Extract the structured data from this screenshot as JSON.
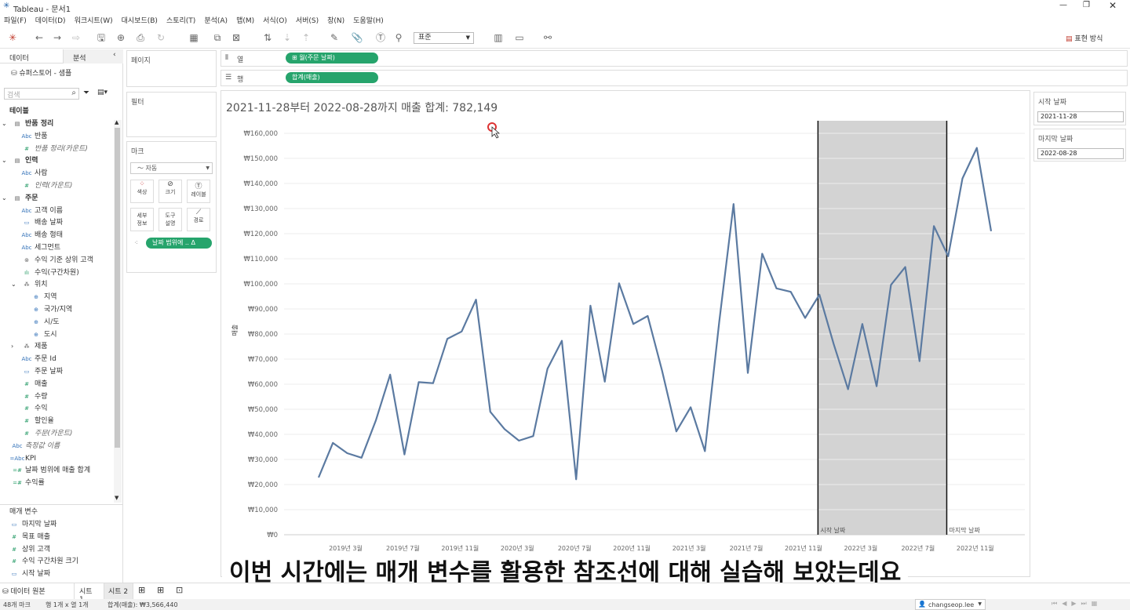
{
  "window": {
    "title": "Tableau - 문서1"
  },
  "menu": [
    "파일(F)",
    "데이터(D)",
    "워크시트(W)",
    "대시보드(B)",
    "스토리(T)",
    "분석(A)",
    "맵(M)",
    "서식(O)",
    "서버(S)",
    "창(N)",
    "도움말(H)"
  ],
  "toolbar": {
    "fit_select": "표준",
    "show_me": "표현 방식"
  },
  "data_pane": {
    "tab_data": "데이터",
    "tab_analysis": "분석",
    "datasource": "슈퍼스토어 - 샘플",
    "search_placeholder": "검색",
    "tables_header": "테이블",
    "items": [
      {
        "icon": "table",
        "label": "반품 정리",
        "bold": true,
        "indent": 1,
        "expand": "⌄"
      },
      {
        "icon": "Abc",
        "label": "반품",
        "indent": 2
      },
      {
        "icon": "#",
        "label": "반품 정리(카운트)",
        "indent": 2,
        "italic": true
      },
      {
        "icon": "table",
        "label": "인력",
        "bold": true,
        "indent": 1,
        "expand": "⌄"
      },
      {
        "icon": "Abc",
        "label": "사람",
        "indent": 2
      },
      {
        "icon": "#",
        "label": "인력(카운트)",
        "indent": 2,
        "italic": true
      },
      {
        "icon": "table",
        "label": "주문",
        "bold": true,
        "indent": 1,
        "expand": "⌄"
      },
      {
        "icon": "Abc",
        "label": "고객 이름",
        "indent": 2
      },
      {
        "icon": "cal",
        "label": "배송 날짜",
        "indent": 2
      },
      {
        "icon": "Abc",
        "label": "배송 형태",
        "indent": 2
      },
      {
        "icon": "Abc",
        "label": "세그먼트",
        "indent": 2
      },
      {
        "icon": "set",
        "label": "수익 기준 상위 고객",
        "indent": 2
      },
      {
        "icon": "bin",
        "label": "수익(구간차원)",
        "indent": 2
      },
      {
        "icon": "hier",
        "label": "위치",
        "indent": 2,
        "expand": "⌄"
      },
      {
        "icon": "globe",
        "label": "지역",
        "indent": 3
      },
      {
        "icon": "globe",
        "label": "국가/지역",
        "indent": 3
      },
      {
        "icon": "globe",
        "label": "시/도",
        "indent": 3
      },
      {
        "icon": "globe",
        "label": "도시",
        "indent": 3
      },
      {
        "icon": "hier",
        "label": "제품",
        "indent": 2,
        "expand": "›"
      },
      {
        "icon": "Abc",
        "label": "주문 Id",
        "indent": 2
      },
      {
        "icon": "cal",
        "label": "주문 날짜",
        "indent": 2
      },
      {
        "icon": "#",
        "label": "매출",
        "indent": 2
      },
      {
        "icon": "#",
        "label": "수량",
        "indent": 2
      },
      {
        "icon": "#",
        "label": "수익",
        "indent": 2
      },
      {
        "icon": "#",
        "label": "할인율",
        "indent": 2
      },
      {
        "icon": "#",
        "label": "주문(카운트)",
        "indent": 2,
        "italic": true
      },
      {
        "icon": "Abc",
        "label": "측정값 이름",
        "indent": 1,
        "italic": true
      },
      {
        "icon": "=Abc",
        "label": "KPI",
        "indent": 1
      },
      {
        "icon": "=#",
        "label": "날짜 범위에 매출 합계",
        "indent": 1
      },
      {
        "icon": "=#",
        "label": "수익률",
        "indent": 1
      }
    ],
    "params_header": "매개 변수",
    "params": [
      {
        "icon": "cal",
        "label": "마지막 날짜"
      },
      {
        "icon": "#",
        "label": "목표 매출"
      },
      {
        "icon": "#",
        "label": "상위 고객"
      },
      {
        "icon": "#",
        "label": "수익 구간차원 크기"
      },
      {
        "icon": "cal",
        "label": "시작 날짜"
      }
    ]
  },
  "cards": {
    "pages": "페이지",
    "filters": "필터",
    "marks": "마크",
    "mark_type": "자동",
    "mark_buttons": [
      "색상",
      "크기",
      "레이블",
      "세부\n정보",
      "도구\n설명",
      "경로"
    ],
    "mark_pill": "날짜 범위에 .. Δ"
  },
  "shelves": {
    "columns_label": "열",
    "rows_label": "행",
    "columns_pill": "월(주문 날짜)",
    "rows_pill": "합계(매출)"
  },
  "params_panel": {
    "start_label": "시작 날짜",
    "start_value": "2021-11-28",
    "end_label": "마지막 날짜",
    "end_value": "2022-08-28"
  },
  "chart_data": {
    "type": "line",
    "title": "2021-11-28부터 2022-08-28까지 매출 합계: 782,149",
    "ylabel": "매출",
    "xlabel": "",
    "ylim": [
      0,
      165000
    ],
    "yticks": [
      0,
      10000,
      20000,
      30000,
      40000,
      50000,
      60000,
      70000,
      80000,
      90000,
      100000,
      110000,
      120000,
      130000,
      140000,
      150000,
      160000
    ],
    "ytick_labels": [
      "₩0",
      "₩10,000",
      "₩20,000",
      "₩30,000",
      "₩40,000",
      "₩50,000",
      "₩60,000",
      "₩70,000",
      "₩80,000",
      "₩90,000",
      "₩100,000",
      "₩110,000",
      "₩120,000",
      "₩130,000",
      "₩140,000",
      "₩150,000",
      "₩160,000"
    ],
    "xtick_labels": [
      "2019년 3월",
      "2019년 7월",
      "2019년 11월",
      "2020년 3월",
      "2020년 7월",
      "2020년 11월",
      "2021년 3월",
      "2021년 7월",
      "2021년 11월",
      "2022년 3월",
      "2022년 7월",
      "2022년 11월"
    ],
    "xtick_index": [
      2,
      6,
      10,
      14,
      18,
      22,
      26,
      30,
      34,
      38,
      42,
      46
    ],
    "x_start": "2019-01",
    "series": [
      {
        "values": [
          22800,
          36600,
          32500,
          30700,
          45500,
          63800,
          32000,
          60800,
          60400,
          78100,
          81000,
          93700,
          49000,
          42100,
          37500,
          39300,
          66200,
          77300,
          22100,
          91300,
          61000,
          100200,
          84000,
          87200,
          65500,
          41200,
          50800,
          33300,
          85000,
          131800,
          64500,
          112000,
          98200,
          96800,
          86400,
          95700,
          76000,
          58000,
          84000,
          59200,
          99600,
          106700,
          69200,
          123000,
          111000,
          142000,
          154200,
          121000
        ]
      }
    ],
    "reference_band": {
      "start_index": 34.9,
      "end_index": 43.9,
      "start_label": "시작 날짜",
      "end_label": "마지막 날짜"
    },
    "line_color": "#5b7aa1",
    "band_color": "#d3d3d3"
  },
  "tabs": {
    "datasource": "데이터 원본",
    "sheets": [
      "시트 1",
      "시트 2"
    ]
  },
  "caption": "이번 시간에는 매개 변수를 활용한 참조선에 대해 실습해 보았는데요",
  "status": {
    "marks": "48개 마크",
    "rows": "행 1개 x 열 1개",
    "sum": "합계(매출): ₩3,566,440",
    "user": "changseop.lee"
  }
}
